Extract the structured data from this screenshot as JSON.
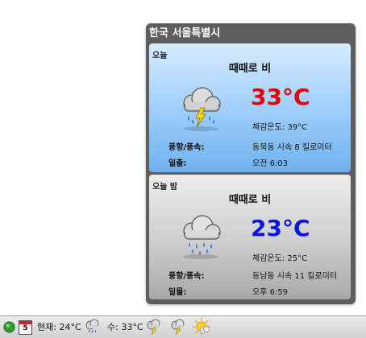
{
  "popup": {
    "title": "한국 서울특별시",
    "day": {
      "label": "오늘",
      "condition": "때때로 비",
      "icon": "thunderstorm-rain-icon",
      "temperature": "33°C",
      "temp_color": "#e60000",
      "feels_like": "체감온도: 39°C",
      "wind_label": "풍향/풍속:",
      "wind_value": "동북동 시속 8 킬로미터",
      "sun_label": "일출:",
      "sun_value": "오전 6:03"
    },
    "night": {
      "label": "오늘 밤",
      "condition": "때때로 비",
      "icon": "rain-cloud-icon",
      "temperature": "23°C",
      "temp_color": "#0a14e6",
      "feels_like": "체감온도: 25°C",
      "wind_label": "풍향/풍속:",
      "wind_value": "동남동 시속 11 킬로미터",
      "sun_label": "일몰:",
      "sun_value": "오후 6:59"
    }
  },
  "statusbar": {
    "calendar_day": "5",
    "current": "현재: 24°C",
    "wed": "수: 33°C",
    "icons": [
      "green-status-icon",
      "calendar-icon",
      "rain-cloud-icon",
      "thunderstorm-icon",
      "thunderstorm-icon",
      "sun-cloud-icon"
    ]
  }
}
